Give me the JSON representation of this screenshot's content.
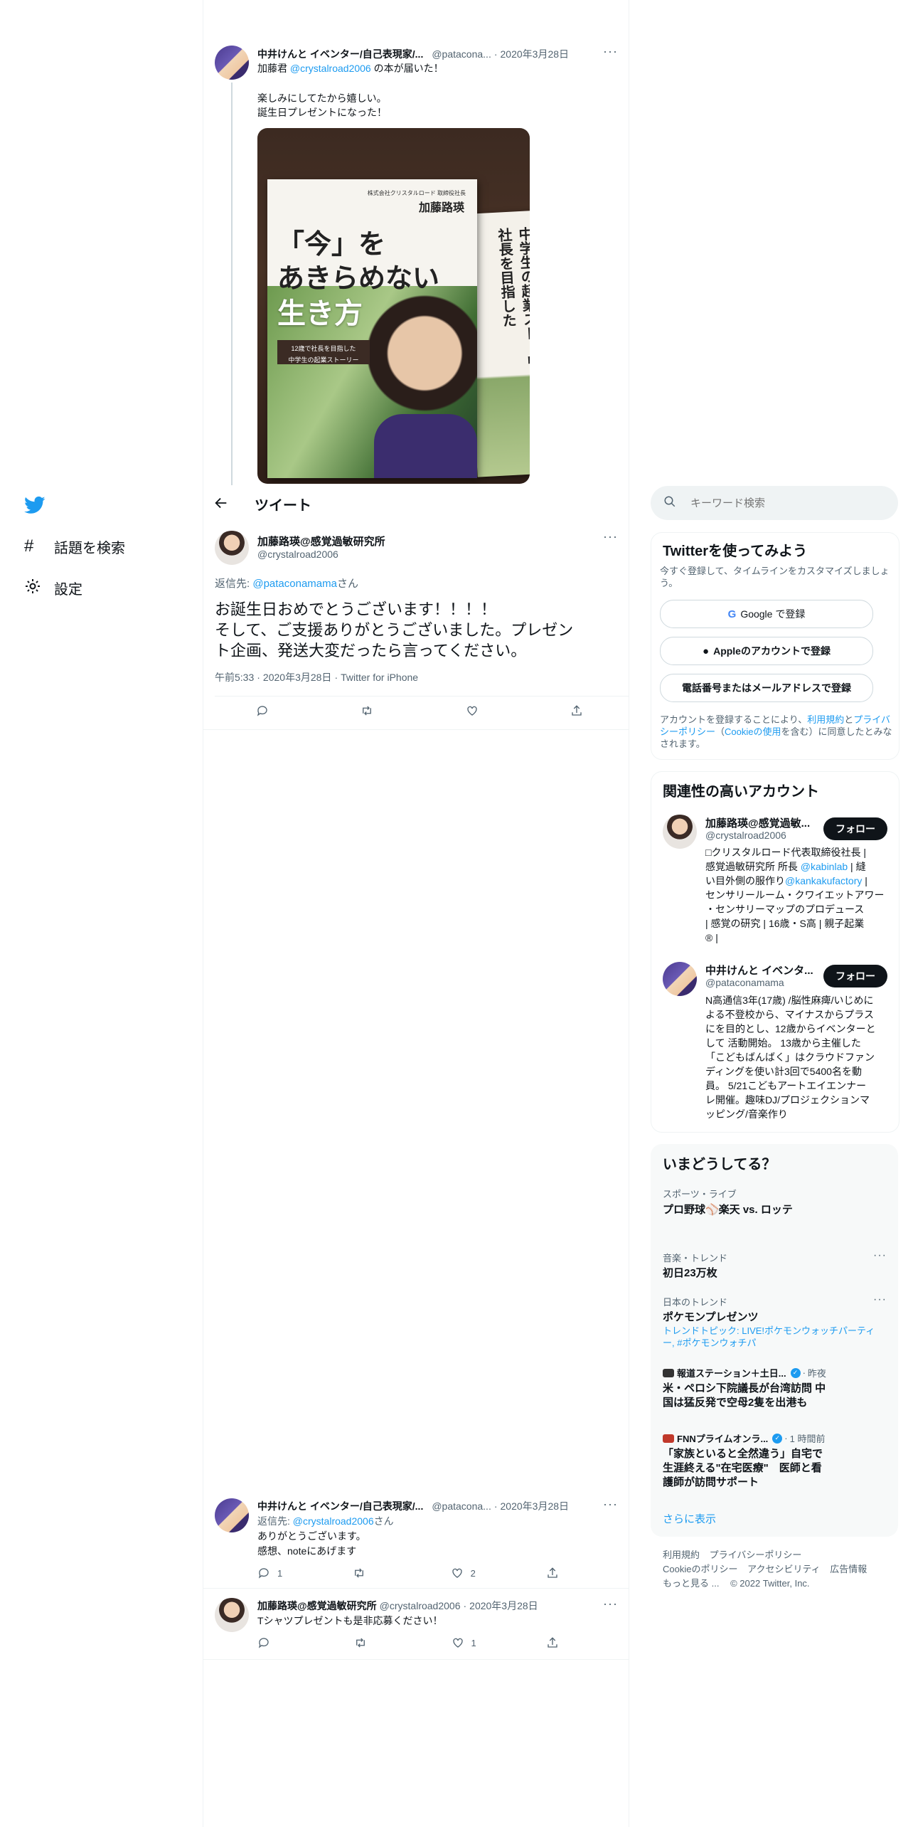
{
  "nav": {
    "explore_label": "話題を検索",
    "settings_label": "設定"
  },
  "header": {
    "title": "ツイート"
  },
  "parent_tweet": {
    "name": "中井けんと イベンター/自己表現家/...",
    "handle": "@patacona...",
    "date": "2020年3月28日",
    "text_prefix": "加藤君",
    "mention": "@crystalroad2006",
    "text_suffix": "の本が届いた！",
    "line2": "楽しみにしてたから嬉しい。",
    "line3": "誕生日プレゼントになった！",
    "book": {
      "publisher": "株式会社クリスタルロード 取締役社長",
      "author": "加藤路瑛",
      "title_1": "「今」を",
      "title_2": "あきらめない",
      "title_3": "生き方",
      "band_1": "12歳で社長を目指した",
      "band_2": "中学生の起業ストーリー",
      "spine": "中学生の起業ストーリー社長を目指した"
    }
  },
  "main_tweet": {
    "name": "加藤路瑛@感覚過敏研究所",
    "handle": "@crystalroad2006",
    "reply_prefix": "返信先:",
    "reply_to": "@pataconamama",
    "reply_suffix": "さん",
    "text_line1": "お誕生日おめでとうございます！！！！",
    "text_line2": "そして、ご支援ありがとうございました。プレゼン",
    "text_line3": "ト企画、発送大変だったら言ってください。",
    "time": "午前5:33",
    "date": "2020年3月28日",
    "source": "Twitter for iPhone"
  },
  "replies": [
    {
      "name": "中井けんと イベンター/自己表現家/...",
      "handle": "@patacona...",
      "date": "2020年3月28日",
      "reply_prefix": "返信先:",
      "reply_to": "@crystalroad2006",
      "reply_suffix": "さん",
      "line1": "ありがとうございます。",
      "line2": "感想、noteにあげます",
      "reply_count": "1",
      "like_count": "2"
    },
    {
      "name": "加藤路瑛@感覚過敏研究所",
      "handle": "@crystalroad2006",
      "date": "2020年3月28日",
      "line1": "Tシャツプレゼントも是非応募ください！",
      "like_count": "1"
    }
  ],
  "search": {
    "placeholder": "キーワード検索"
  },
  "signup": {
    "title": "Twitterを使ってみよう",
    "subtitle_1": "今すぐ登録して、タイムラインをカスタマイズしましょ",
    "subtitle_2": "う。",
    "google_label": "Google で登録",
    "apple_label": "Appleのアカウントで登録",
    "phone_label": "電話番号またはメールアドレスで登録",
    "legal_1": "アカウントを登録することにより、",
    "legal_tos": "利用規約",
    "legal_and": "と",
    "legal_privacy": "プライバシーポリシー",
    "legal_2": "（",
    "legal_cookie": "Cookieの使用",
    "legal_3": "を含む）に同意したと",
    "legal_4": "みなされます。"
  },
  "related": {
    "title": "関連性の高いアカウント",
    "follow_label": "フォロー",
    "accounts": [
      {
        "name": "加藤路瑛@感覚過敏...",
        "handle": "@crystalroad2006",
        "bio_1": "□クリスタルロード代表取締役社長 |",
        "bio_2a": "感覚過敏研究所 所長 ",
        "bio_2b": "@kabinlab",
        "bio_2c": " | 縫",
        "bio_3a": "い目外側の服作り",
        "bio_3b": "@kankakufactory",
        "bio_3c": " |",
        "bio_4": "センサリールーム・クワイエットアワー",
        "bio_5": "・センサリーマップのプロデュース",
        "bio_6": "| 感覚の研究 | 16歳・S高 | 親子起業",
        "bio_7": "® |"
      },
      {
        "name": "中井けんと イベンタ...",
        "handle": "@pataconamama",
        "bio_1": "N高通信3年(17歳) /脳性麻痺/いじめに",
        "bio_2": "よる不登校から、マイナスからプラス",
        "bio_3": "にを目的とし、12歳からイベンターと",
        "bio_4": "して 活動開始。 13歳から主催した",
        "bio_5": "「こどもばんばく」はクラウドファン",
        "bio_6": "ディングを使い計3回で5400名を動",
        "bio_7": "員。 5/21こどもアートエイエンナー",
        "bio_8": "レ開催。趣味DJ/プロジェクションマ",
        "bio_9": "ッピング/音楽作り"
      }
    ]
  },
  "trends": {
    "title": "いまどうしてる？",
    "items": [
      {
        "category": "スポーツ・ライブ",
        "title": "プロ野球⚾楽天 vs. ロッテ"
      },
      {
        "category": "音楽・トレンド",
        "title": "初日23万枚"
      },
      {
        "category": "日本のトレンド",
        "title": "ポケモンプレゼンツ",
        "sub_1": "トレンドトピック: LIVE!ポケモンウォッチパーティ",
        "sub_2": "ー, #ポケモンウォチパ"
      },
      {
        "source": "報道ステーション＋土日...",
        "time": "昨夜",
        "title_1": "米・ペロシ下院議長が台湾訪問 中",
        "title_2": "国は猛反発で空母2隻を出港も"
      },
      {
        "source": "FNNプライムオンラ...",
        "time": "1 時間前",
        "title_1": "「家族といると全然違う」自宅で",
        "title_2": "生涯終える\"在宅医療\"　医師と看",
        "title_3": "護師が訪問サポート"
      }
    ],
    "show_more": "さらに表示"
  },
  "footer": {
    "tos": "利用規約",
    "privacy": "プライバシーポリシー",
    "cookie": "Cookieのポリシー",
    "accessibility": "アクセシビリティ",
    "ads": "広告情報",
    "more": "もっと見る ...",
    "copyright": "© 2022 Twitter, Inc."
  },
  "colors": {
    "accent": "#1d9bf0",
    "text": "#0f1419",
    "muted": "#536471",
    "border": "#eff3f4"
  }
}
